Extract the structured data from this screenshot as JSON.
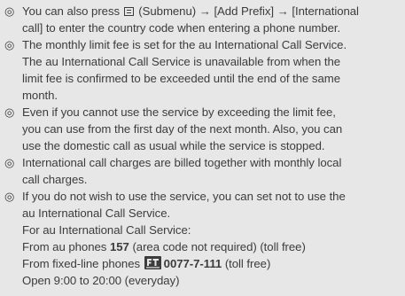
{
  "notes": {
    "marker": "◎",
    "item1": {
      "line1_before_icon": "You can also press",
      "line1_after_icon": "(Submenu) → [Add Prefix] → [International",
      "line2": "call] to enter the country code when entering a phone number."
    },
    "item2": {
      "line1": "The monthly limit fee is set for the au International Call Service.",
      "line2": "The au International Call Service is unavailable from when the",
      "line3": "limit fee is confirmed to be exceeded until the end of the same",
      "line4": "month."
    },
    "item3": {
      "line1": "Even if you cannot use the service by exceeding the limit fee,",
      "line2": "you can use from the first day of the next month. Also, you can",
      "line3": "use the domestic call as usual while the service is stopped."
    },
    "item4": {
      "line1": "International call charges are billed together with monthly local",
      "line2": "call charges."
    },
    "item5": {
      "line1": "If you do not wish to use the service, you can set not to use the",
      "line2": "au International Call Service.",
      "line3": "For au International Call Service:",
      "line4_prefix": "From au phones",
      "line4_number": "157",
      "line4_suffix": "(area code not required) (toll free)",
      "line5_prefix": "From fixed-line phones",
      "line5_number": "0077-7-111",
      "line5_suffix": "(toll free)",
      "line6": "Open 9:00 to 20:00 (everyday)"
    }
  },
  "icons": {
    "submenu_key": "submenu-key-icon",
    "free_dial": "free-dial-icon"
  }
}
